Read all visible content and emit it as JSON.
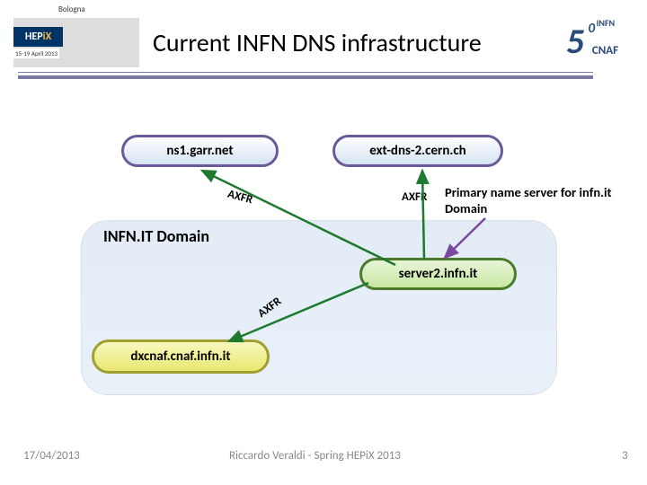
{
  "header": {
    "title": "Current INFN DNS infrastructure",
    "hepix_prefix": "HEP",
    "hepix_suffix": "iX",
    "bologna": "Bologna",
    "dates": "15-19 April 2013",
    "fifty_main": "5",
    "fifty_zero": "0",
    "fifty_infn": "INFN",
    "fifty_cnaf": "CNAF"
  },
  "domain": {
    "label": "INFN.IT Domain"
  },
  "nodes": {
    "ns1": "ns1.garr.net",
    "ext": "ext-dns-2.cern.ch",
    "server2": "server2.infn.it",
    "dxcnaf": "dxcnaf.cnaf.infn.it"
  },
  "labels": {
    "axfr1": "AXFR",
    "axfr2": "AXFR",
    "axfr3": "AXFR",
    "primary_note": "Primary name server for infn.it Domain"
  },
  "footer": {
    "date": "17/04/2013",
    "author": "Riccardo Veraldi - Spring HEPiX 2013",
    "page": "3"
  },
  "colors": {
    "arrow_green": "#1d7a2e",
    "arrow_purple": "#7a4aa0"
  }
}
